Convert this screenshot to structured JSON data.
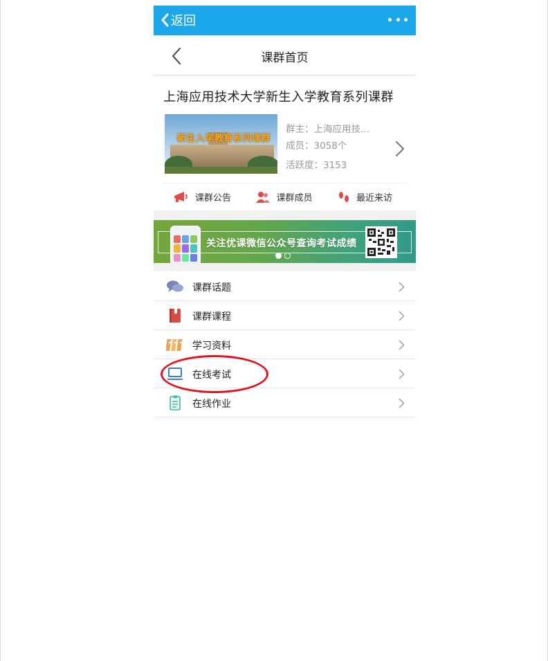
{
  "topbar": {
    "back_label": "返回",
    "more_icon": "more-dots-icon",
    "bg_color": "#1ba7ea"
  },
  "subheader": {
    "title": "课群首页"
  },
  "group": {
    "title": "上海应用技术大学新生入学教育系列课群",
    "thumbnail_text": "新生入学教育系列课群",
    "owner": "群主：上海应用技...",
    "members": "成员：3058个",
    "activity": "活跃度：3153"
  },
  "actions": [
    {
      "label": "课群公告",
      "icon": "megaphone-icon"
    },
    {
      "label": "课群成员",
      "icon": "members-icon"
    },
    {
      "label": "最近来访",
      "icon": "footprints-icon"
    }
  ],
  "banner": {
    "text": "关注优课微信公众号查询考试成绩",
    "slides": 2,
    "active_slide": 1
  },
  "menu": [
    {
      "label": "课群话题",
      "icon": "chat-bubbles-icon"
    },
    {
      "label": "课群课程",
      "icon": "book-icon"
    },
    {
      "label": "学习资料",
      "icon": "binders-icon"
    },
    {
      "label": "在线考试",
      "icon": "laptop-icon"
    },
    {
      "label": "在线作业",
      "icon": "clipboard-icon"
    }
  ],
  "colors": {
    "accent": "#1ba7ea",
    "annotation": "#e0151b"
  }
}
